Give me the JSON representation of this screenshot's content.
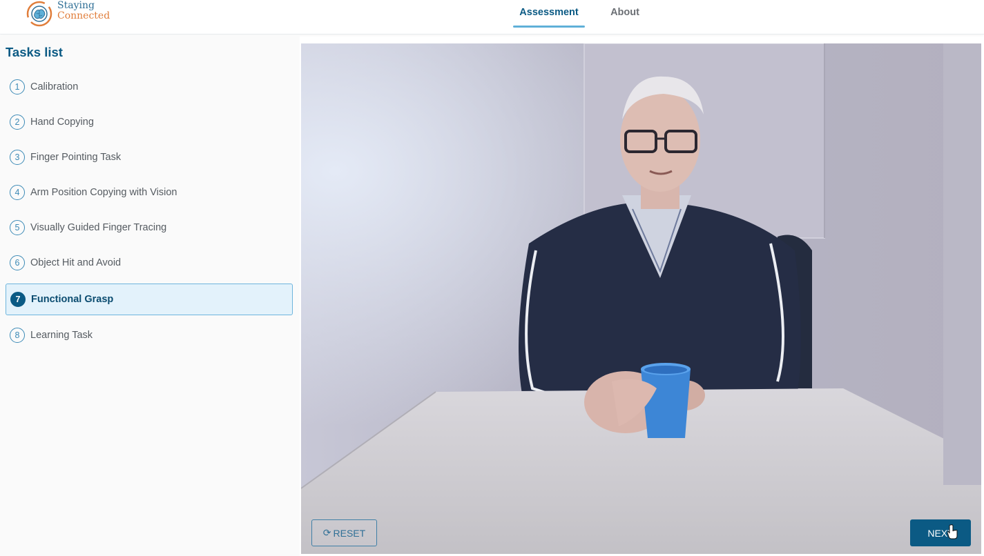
{
  "brand": {
    "line1": "Staying",
    "line2": "Connected",
    "logo_icon": "brain-hands-logo-icon"
  },
  "nav": {
    "tabs": [
      {
        "label": "Assessment",
        "active": true
      },
      {
        "label": "About",
        "active": false
      }
    ]
  },
  "sidebar": {
    "title": "Tasks list",
    "tasks": [
      {
        "num": "1",
        "label": "Calibration"
      },
      {
        "num": "2",
        "label": "Hand Copying"
      },
      {
        "num": "3",
        "label": "Finger Pointing Task"
      },
      {
        "num": "4",
        "label": "Arm Position Copying with Vision"
      },
      {
        "num": "5",
        "label": "Visually Guided Finger Tracing"
      },
      {
        "num": "6",
        "label": "Object Hit and Avoid"
      },
      {
        "num": "7",
        "label": "Functional Grasp"
      },
      {
        "num": "8",
        "label": "Learning Task"
      }
    ],
    "active_task": "7"
  },
  "video": {
    "description_icon": "video-feed-icon"
  },
  "controls": {
    "reset_label": "RESET",
    "reset_icon": "refresh-icon",
    "next_label": "NEXT"
  },
  "colors": {
    "primary": "#0b5a84",
    "accent": "#5fb0d8",
    "active_bg": "#e3f2fb"
  }
}
